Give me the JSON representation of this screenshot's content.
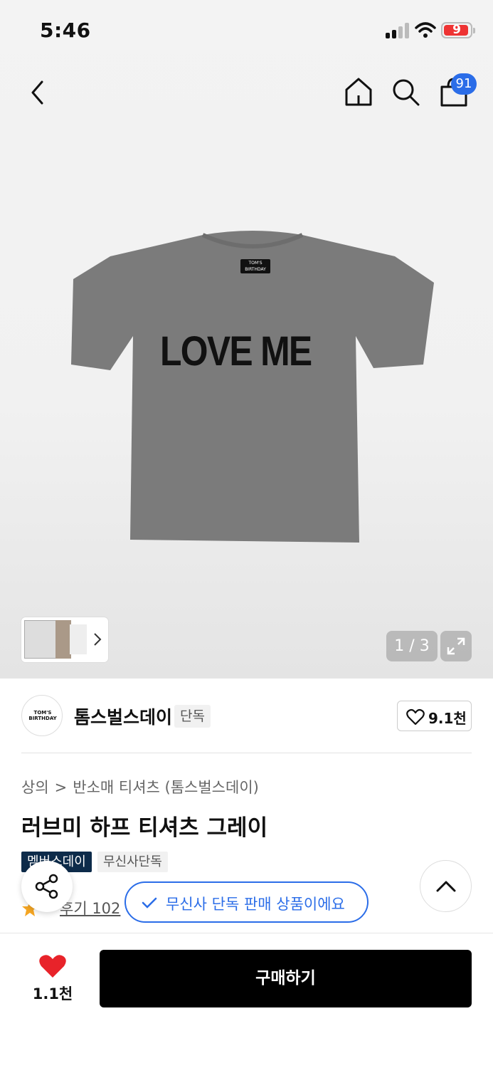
{
  "status_bar": {
    "time": "5:46",
    "battery": "9"
  },
  "header": {
    "cart_count": "91"
  },
  "gallery": {
    "counter": "1 / 3",
    "product_print": "LOVE ME",
    "neck_label": "TOM'S BIRTHDAY"
  },
  "brand": {
    "name": "톰스벌스데이",
    "exclusive_tag": "단독",
    "like_count": "9.1천",
    "logo_text": "TOM'S BIRTHDAY"
  },
  "breadcrumb": [
    "상의",
    "반소매 티셔츠 (톰스벌스데이)"
  ],
  "product": {
    "title": "러브미 하프 티셔츠 그레이",
    "tags": [
      "멤버스데이",
      "무신사단독"
    ],
    "review_text": "후기 102"
  },
  "toast": {
    "text": "무신사 단독 판매 상품이에요"
  },
  "bottom_bar": {
    "like_count": "1.1천",
    "buy_label": "구매하기"
  },
  "colors": {
    "accent": "#2b6de8",
    "member_tag": "#0d2b4a",
    "heart": "#e8232a",
    "buy": "#000000"
  }
}
